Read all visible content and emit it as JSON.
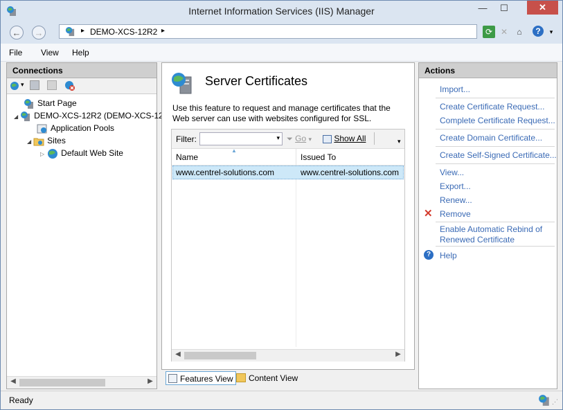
{
  "window": {
    "title": "Internet Information Services (IIS) Manager",
    "minimize": "—",
    "maximize": "☐",
    "close": "✕"
  },
  "address": {
    "breadcrumb": "DEMO-XCS-12R2",
    "sep1": "▸",
    "sep2": "▸"
  },
  "nav": {
    "back": "←",
    "forward": "→"
  },
  "menu": {
    "file": "File",
    "view": "View",
    "help": "Help"
  },
  "connections": {
    "header": "Connections",
    "tree": [
      {
        "label": "Start Page"
      },
      {
        "label": "DEMO-XCS-12R2 (DEMO-XCS-12"
      },
      {
        "label": "Application Pools"
      },
      {
        "label": "Sites"
      },
      {
        "label": "Default Web Site"
      }
    ]
  },
  "feature": {
    "title": "Server Certificates",
    "description": "Use this feature to request and manage certificates that the Web server can use with websites configured for SSL.",
    "filter_label": "Filter:",
    "go_label": "Go",
    "show_all_label": "Show All",
    "columns": [
      "Name",
      "Issued To"
    ],
    "rows": [
      {
        "name": "www.centrel-solutions.com",
        "issued_to": "www.centrel-solutions.com"
      }
    ]
  },
  "view_tabs": {
    "features": "Features View",
    "content": "Content View"
  },
  "actions": {
    "header": "Actions",
    "items": [
      "Import...",
      "Create Certificate Request...",
      "Complete Certificate Request...",
      "Create Domain Certificate...",
      "Create Self-Signed Certificate...",
      "View...",
      "Export...",
      "Renew...",
      "Remove",
      "Enable Automatic Rebind of Renewed Certificate",
      "Help"
    ]
  },
  "status": {
    "text": "Ready"
  },
  "colors": {
    "link": "#3a6ab5",
    "remove_icon": "#d33a2c",
    "help_icon": "#2c6fc4",
    "selection": "#cde8f8"
  }
}
